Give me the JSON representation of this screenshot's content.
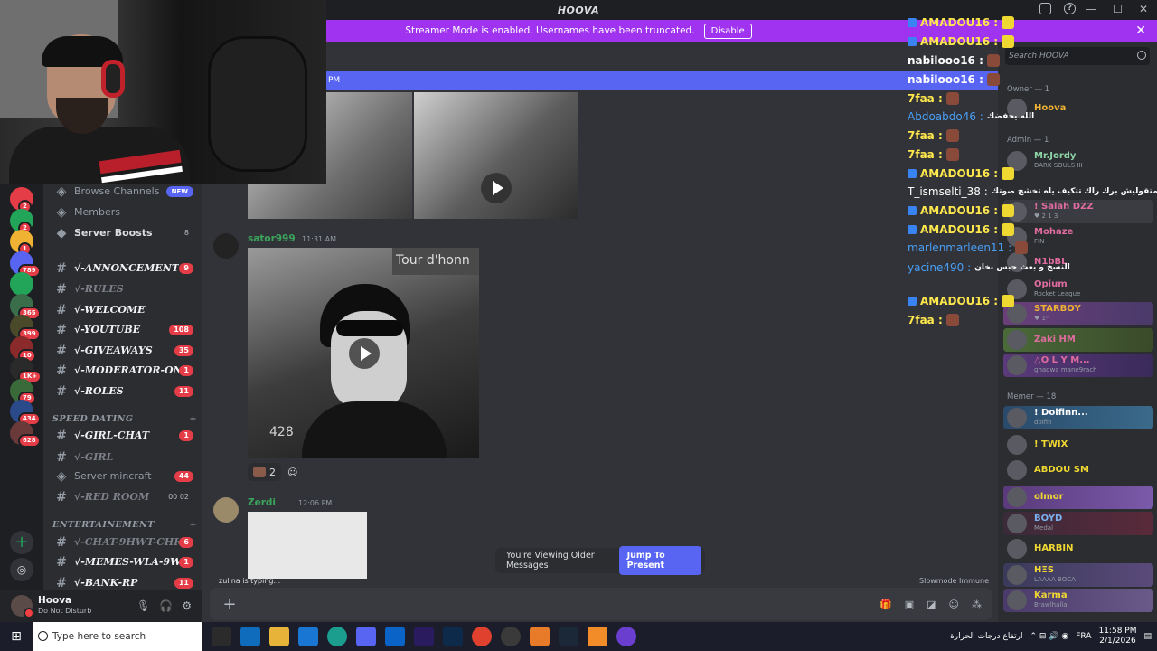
{
  "window": {
    "title": "HOOVA"
  },
  "banner": {
    "text": "Streamer Mode is enabled. Usernames have been truncated.",
    "button": "Disable"
  },
  "channels": [
    {
      "name": "Browse Channels",
      "badge": "NEW",
      "kind": "plain"
    },
    {
      "name": "Members",
      "kind": "plain"
    },
    {
      "name": "Server Boosts",
      "count": "8",
      "kind": "white"
    },
    {
      "name": "√-ANNONCEMENTS...",
      "count": "9",
      "kind": "bold"
    },
    {
      "name": "√-RULES",
      "kind": "muted"
    },
    {
      "name": "√-WELCOME",
      "kind": "bold"
    },
    {
      "name": "√-YOUTUBE",
      "count": "108",
      "kind": "bold"
    },
    {
      "name": "√-GIVEAWAYS",
      "count": "35",
      "kind": "bold"
    },
    {
      "name": "√-MODERATOR-ON...",
      "count": "1",
      "kind": "bold"
    },
    {
      "name": "√-ROLES",
      "count": "11",
      "kind": "bold"
    }
  ],
  "categories": {
    "speed": "SPEED DATING",
    "ent": "ENTERTAINEMENT"
  },
  "channels2": [
    {
      "name": "√-GIRL-CHAT",
      "count": "1",
      "kind": "bold"
    },
    {
      "name": "√-GIRL",
      "kind": "muted"
    },
    {
      "name": "Server mincraft",
      "count": "44",
      "kind": "plain"
    },
    {
      "name": "√-RED ROOM",
      "extra": "00 02",
      "kind": "muted"
    }
  ],
  "channels3": [
    {
      "name": "√-CHAT-9HWT-CHR...",
      "count": "6",
      "kind": "muted"
    },
    {
      "name": "√-MEMES-WLA-9W...",
      "count": "1",
      "kind": "bold"
    },
    {
      "name": "√-BANK-RP",
      "count": "11",
      "kind": "bold"
    }
  ],
  "servers": [
    {
      "badge": "2"
    },
    {
      "badge": "2"
    },
    {
      "badge": "1"
    },
    {
      "badge": "789"
    },
    {
      "badge": ""
    },
    {
      "badge": "365"
    },
    {
      "badge": "399"
    },
    {
      "badge": "10"
    },
    {
      "badge": "1K+"
    },
    {
      "badge": "79"
    },
    {
      "badge": "434"
    },
    {
      "badge": "628"
    }
  ],
  "user": {
    "name": "Hoova",
    "status": "Do Not Disturb"
  },
  "messages": [
    {
      "author": "sator999",
      "time": "11:31 AM",
      "video_text": "Tour d'honn",
      "likes": "428",
      "reaction_count": "2"
    },
    {
      "author": "Zerdi",
      "time": "12:06 PM"
    }
  ],
  "typing": "zulina is typing...",
  "slowmode": "Slowmode Immune",
  "older": {
    "text": "You're Viewing Older Messages",
    "button": "Jump To Present"
  },
  "overlay": [
    {
      "name": "AMADOU16 :",
      "text": ""
    },
    {
      "name": "AMADOU16 :",
      "text": ""
    },
    {
      "name": "nabilooo16 :",
      "text": ""
    },
    {
      "name": "nabilooo16 :",
      "text": ""
    },
    {
      "name": "7faa :",
      "text": ""
    },
    {
      "name": "Abdoabdo46 :",
      "text": "الله يحفضك"
    },
    {
      "name": "7faa :",
      "text": ""
    },
    {
      "name": "7faa :",
      "text": ""
    },
    {
      "name": "AMADOU16 :",
      "text": ""
    },
    {
      "name": "T_ismselti_38 :",
      "text": "متقوليش برك راك تتكيف ياه تخشخ صوتك"
    },
    {
      "name": "AMADOU16 :",
      "text": ""
    },
    {
      "name": "AMADOU16 :",
      "text": ""
    },
    {
      "name": "marlenmarleen11 :",
      "text": ""
    },
    {
      "name": "yacine490 :",
      "text": "النسخ و بعث حبس نخان"
    },
    {
      "name": "AMADOU16 :",
      "text": ""
    },
    {
      "name": "7faa :",
      "text": ""
    }
  ],
  "members": {
    "search": "Search HOOVA",
    "owner_label": "Owner — 1",
    "admin_label": "Admin — 1",
    "memer_label": "Memer — 18",
    "owner": [
      {
        "name": "Hoova",
        "sub": "",
        "color": "#f0b232"
      }
    ],
    "admin": [
      {
        "name": "Mr.Jordy",
        "sub": "DARK SOULS III",
        "color": "#8fd4a8"
      },
      {
        "name": "! Salah DZZ",
        "sub": "♥ 2 1 3",
        "color": "#e06c9f"
      },
      {
        "name": "Mohaze",
        "sub": "FIN",
        "color": "#e06c9f"
      },
      {
        "name": "N1bBL",
        "sub": "",
        "color": "#e06c9f"
      },
      {
        "name": "Opium",
        "sub": "Rocket League",
        "color": "#e06c9f"
      },
      {
        "name": "STARBOY",
        "sub": "♥ 1ᵒ",
        "color": "#f0b232"
      },
      {
        "name": "Zaki HM",
        "sub": "",
        "color": "#e06c9f"
      },
      {
        "name": "△O L Y M...",
        "sub": "ghadwa mane9rach",
        "color": "#e06c9f"
      }
    ],
    "memer": [
      {
        "name": "! Dolfinn...",
        "sub": "dolfin",
        "color": "#ffffff"
      },
      {
        "name": "! TWIX",
        "sub": "",
        "color": "#f0d832"
      },
      {
        "name": "ABDOU SM",
        "sub": "",
        "color": "#f0d832"
      },
      {
        "name": "olmor",
        "sub": "",
        "color": "#f0d832"
      },
      {
        "name": "BOYD",
        "sub": "Medal",
        "color": "#7ab0f0"
      },
      {
        "name": "HARBIN",
        "sub": "",
        "color": "#f0d832"
      },
      {
        "name": "HΞS",
        "sub": "LAAAA BOCA",
        "color": "#f0d832"
      },
      {
        "name": "Karma",
        "sub": "Brawlhalla",
        "color": "#f0d832"
      }
    ]
  },
  "taskbar": {
    "search": "Type here to search",
    "weather": "ارتفاع درجات الحرارة",
    "lang": "FRA",
    "time": "11:58 PM",
    "date": "2/1/2026"
  },
  "colors": {
    "accent": "#5865f2",
    "banner": "#a033f0",
    "badge": "#e53d47"
  }
}
